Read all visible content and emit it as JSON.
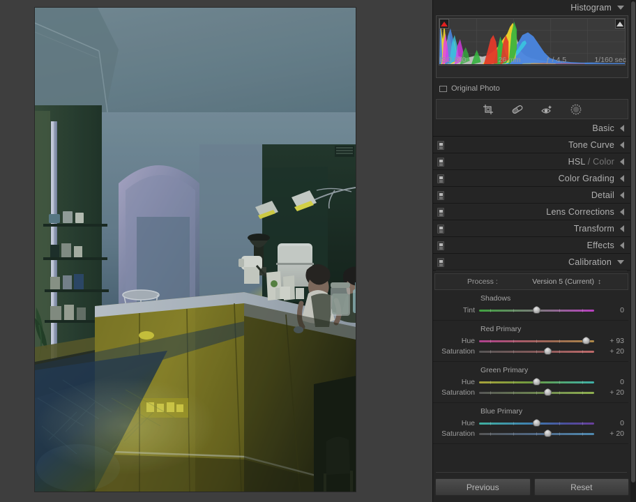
{
  "histogram": {
    "title": "Histogram",
    "collapse_icon": "chevron-down-icon",
    "shadow_clip_icon": "shadow-clipping-triangle-icon",
    "highlight_clip_icon": "highlight-clipping-triangle-icon",
    "exif": {
      "iso": "ISO 800",
      "focal_length": "26 mm",
      "aperture": "ƒ / 4,5",
      "shutter": "1/160 sec"
    },
    "original_photo_label": "Original Photo",
    "original_photo_checked": false
  },
  "tools": [
    {
      "name": "crop-overlay-tool",
      "label": "Crop Overlay"
    },
    {
      "name": "spot-removal-tool",
      "label": "Healing Brush"
    },
    {
      "name": "red-eye-tool",
      "label": "Red Eye Correction"
    },
    {
      "name": "masking-tool",
      "label": "Masking"
    }
  ],
  "panels": [
    {
      "title": "Basic",
      "dim": "",
      "state": "collapsed",
      "switch": false,
      "arrow": "chevron-left-icon"
    },
    {
      "title": "Tone Curve",
      "dim": "",
      "state": "collapsed",
      "switch": true,
      "arrow": "chevron-left-icon"
    },
    {
      "title": "HSL",
      "dim": " / Color",
      "state": "collapsed",
      "switch": true,
      "arrow": "chevron-left-icon"
    },
    {
      "title": "Color Grading",
      "dim": "",
      "state": "collapsed",
      "switch": true,
      "arrow": "chevron-left-icon"
    },
    {
      "title": "Detail",
      "dim": "",
      "state": "collapsed",
      "switch": true,
      "arrow": "chevron-left-icon"
    },
    {
      "title": "Lens Corrections",
      "dim": "",
      "state": "collapsed",
      "switch": true,
      "arrow": "chevron-left-icon"
    },
    {
      "title": "Transform",
      "dim": "",
      "state": "collapsed",
      "switch": true,
      "arrow": "chevron-left-icon"
    },
    {
      "title": "Effects",
      "dim": "",
      "state": "collapsed",
      "switch": true,
      "arrow": "chevron-left-icon"
    },
    {
      "title": "Calibration",
      "dim": "",
      "state": "expanded",
      "switch": true,
      "arrow": "chevron-down-icon"
    }
  ],
  "calibration": {
    "process_label": "Process :",
    "process_value": "Version 5 (Current)",
    "process_stepper_icon": "up-down-stepper-icon",
    "groups": [
      {
        "name": "Shadows",
        "sliders": [
          {
            "label": "Tint",
            "value": "0",
            "percent": 50,
            "gradient": "linear-gradient(90deg,#3fa33f 0%,#7b7b7b 50%,#b93fc0 100%)"
          }
        ]
      },
      {
        "name": "Red Primary",
        "sliders": [
          {
            "label": "Hue",
            "value": "+ 93",
            "percent": 93,
            "gradient": "linear-gradient(90deg,#b0408f 0%,#a85a6a 35%,#9c6a52 65%,#b08a4a 100%)"
          },
          {
            "label": "Saturation",
            "value": "+ 20",
            "percent": 60,
            "gradient": "linear-gradient(90deg,#565656 0%,#8a5a5a 55%,#c06a6a 100%)"
          }
        ]
      },
      {
        "name": "Green Primary",
        "sliders": [
          {
            "label": "Hue",
            "value": "0",
            "percent": 50,
            "gradient": "linear-gradient(90deg,#a8a33a 0%,#6f9a3f 45%,#4fa87a 75%,#3fb0a8 100%)"
          },
          {
            "label": "Saturation",
            "value": "+ 20",
            "percent": 60,
            "gradient": "linear-gradient(90deg,#565656 0%,#6f8a50 55%,#8fb04f 100%)"
          }
        ]
      },
      {
        "name": "Blue Primary",
        "sliders": [
          {
            "label": "Hue",
            "value": "0",
            "percent": 50,
            "gradient": "linear-gradient(90deg,#3fb0a0 0%,#3f7fb0 45%,#4a4f9c 75%,#6a3f9c 100%)"
          },
          {
            "label": "Saturation",
            "value": "+ 20",
            "percent": 60,
            "gradient": "linear-gradient(90deg,#565656 0%,#4f6a8a 55%,#4f8ab0 100%)"
          }
        ]
      }
    ]
  },
  "footer": {
    "previous_label": "Previous",
    "reset_label": "Reset"
  },
  "photo": {
    "alt": "Dimly lit cafe interior with two baristas behind a wooden counter",
    "colors": {
      "ceiling": "#6f8793",
      "wall_blue": "#5b7287",
      "wall_green": "#2e4535",
      "counter_wood": "#8a7d1f",
      "floor_blue": "#2a3c52",
      "lamp_yellow": "#e8e040",
      "dark": "#10140f"
    }
  }
}
